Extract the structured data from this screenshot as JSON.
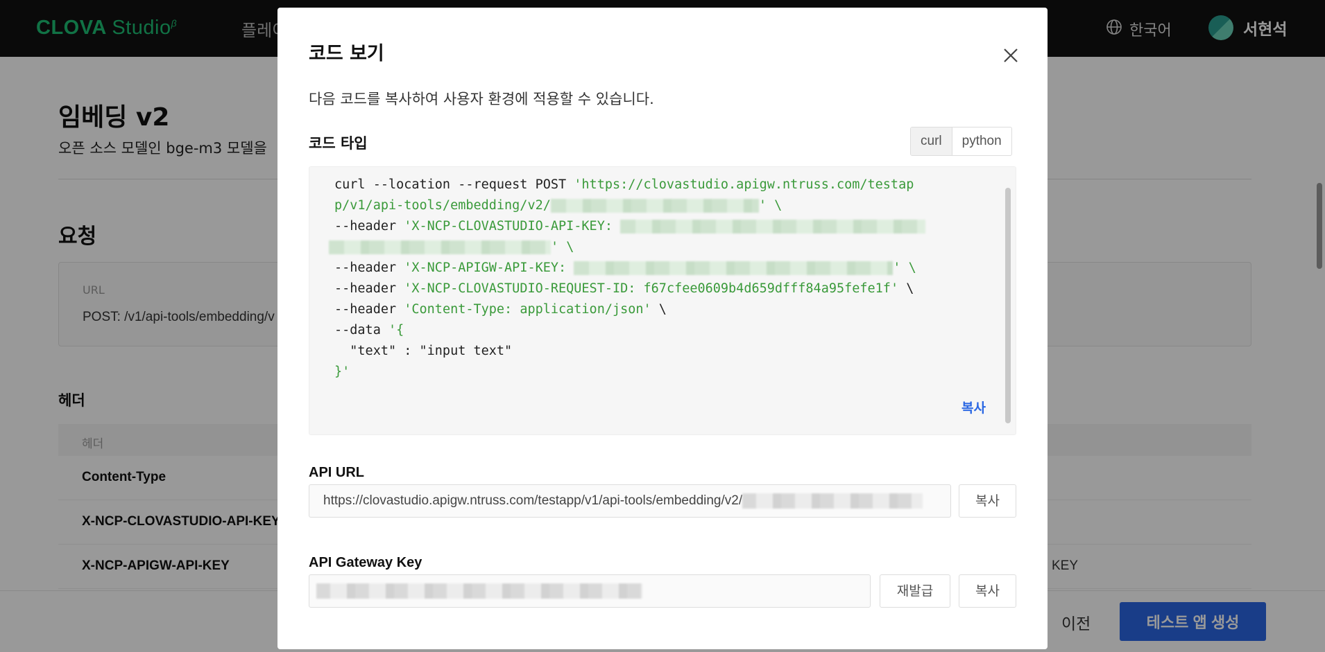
{
  "topbar": {
    "logo_main": "CLOVA",
    "logo_studio": "Studio",
    "logo_beta": "β",
    "nav_item": "플레이",
    "language": "한국어",
    "user_name": "서현석"
  },
  "page": {
    "title": "임베딩 v2",
    "subtitle": "오픈 소스 모델인 bge-m3 모델을",
    "request_title": "요청",
    "url_label": "URL",
    "url_value": "POST: /v1/api-tools/embedding/v",
    "headers_title": "헤더",
    "headers_table_header": "헤더",
    "header_rows": [
      "Content-Type",
      "X-NCP-CLOVASTUDIO-API-KEY",
      "X-NCP-APIGW-API-KEY"
    ],
    "header_row_right": "KEY",
    "prev_label": "이전",
    "create_label": "테스트 앱 생성"
  },
  "modal": {
    "title": "코드 보기",
    "description": "다음 코드를 복사하여 사용자 환경에 적용할 수 있습니다.",
    "code_type_label": "코드 타입",
    "code_tabs": [
      "curl",
      "python"
    ],
    "selected_tab": "curl",
    "code": {
      "l1_cmd": "curl --location --request POST ",
      "l1_url": "'https://clovastudio.apigw.ntruss.com/testap",
      "l2_url": "p/v1/api-tools/embedding/v2/",
      "l2_end": "' \\",
      "l3_cmd": "--header ",
      "l3_str": "'X-NCP-CLOVASTUDIO-API-KEY: ",
      "l4_end": "' \\",
      "l5_cmd": "--header ",
      "l5_str": "'X-NCP-APIGW-API-KEY: ",
      "l5_end": "' \\",
      "l6_cmd": "--header ",
      "l6_str": "'X-NCP-CLOVASTUDIO-REQUEST-ID: f67cfee0609b4d659dfff84a95fefe1f'",
      "l6_end": " \\",
      "l7_cmd": "--header ",
      "l7_str": "'Content-Type: application/json'",
      "l7_end": " \\",
      "l8_cmd": "--data ",
      "l8_str": "'{",
      "l9": "  \"text\" : \"input text\"",
      "l10": "}'"
    },
    "copy_code_label": "복사",
    "api_url_label": "API URL",
    "api_url_value": "https://clovastudio.apigw.ntruss.com/testapp/v1/api-tools/embedding/v2/",
    "copy_url_label": "복사",
    "gateway_key_label": "API Gateway Key",
    "reissue_label": "재발급",
    "copy_key_label": "복사",
    "colors": {
      "accent": "#2a67e3",
      "code_string": "#3a9a3a",
      "brand": "#1dbf73"
    }
  }
}
